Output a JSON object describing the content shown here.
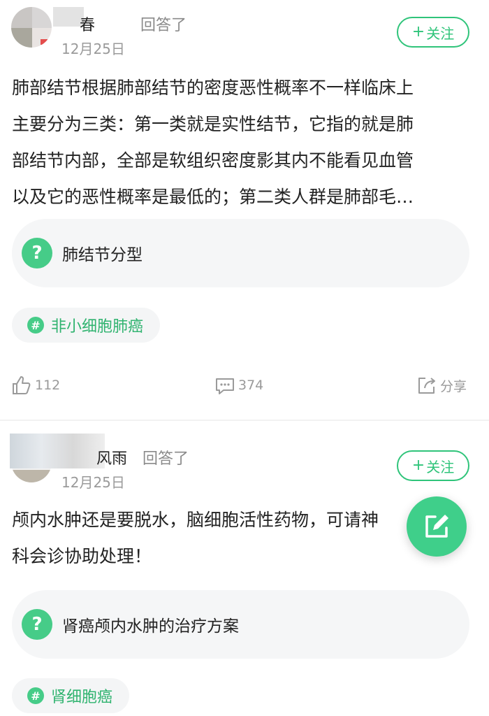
{
  "posts": [
    {
      "author_name": "春",
      "action": "回答了",
      "date": "12月25日",
      "follow_label": "关注",
      "answer_lines": [
        "肺部结节根据肺部结节的密度恶性概率不一样临床上",
        "主要分为三类：第一类就是实性结节，它指的就是肺",
        "部结节内部，全部是软组织密度影其内不能看见血管",
        "以及它的恶性概率是最低的；第二类人群是肺部毛…"
      ],
      "question": "肺结节分型",
      "tag": "非小细胞肺癌",
      "likes": "112",
      "comments": "374",
      "share_label": "分享"
    },
    {
      "author_name": "风雨",
      "action": "回答了",
      "date": "12月25日",
      "follow_label": "关注",
      "answer_lines": [
        "颅内水肿还是要脱水，脑细胞活性药物，可请神",
        "科会诊协助处理！"
      ],
      "question": "肾癌颅内水肿的治疗方案",
      "tag": "肾细胞癌"
    }
  ],
  "colors": {
    "accent": "#2fc47a",
    "accent_light": "#46cc88",
    "card_bg": "#f5f6f7",
    "muted": "#9a9a9a"
  },
  "icons": {
    "question": "question-mark-icon",
    "tag": "hash-icon",
    "like": "thumbs-up-icon",
    "comment": "chat-bubble-icon",
    "share": "share-icon",
    "fab": "edit-icon"
  }
}
